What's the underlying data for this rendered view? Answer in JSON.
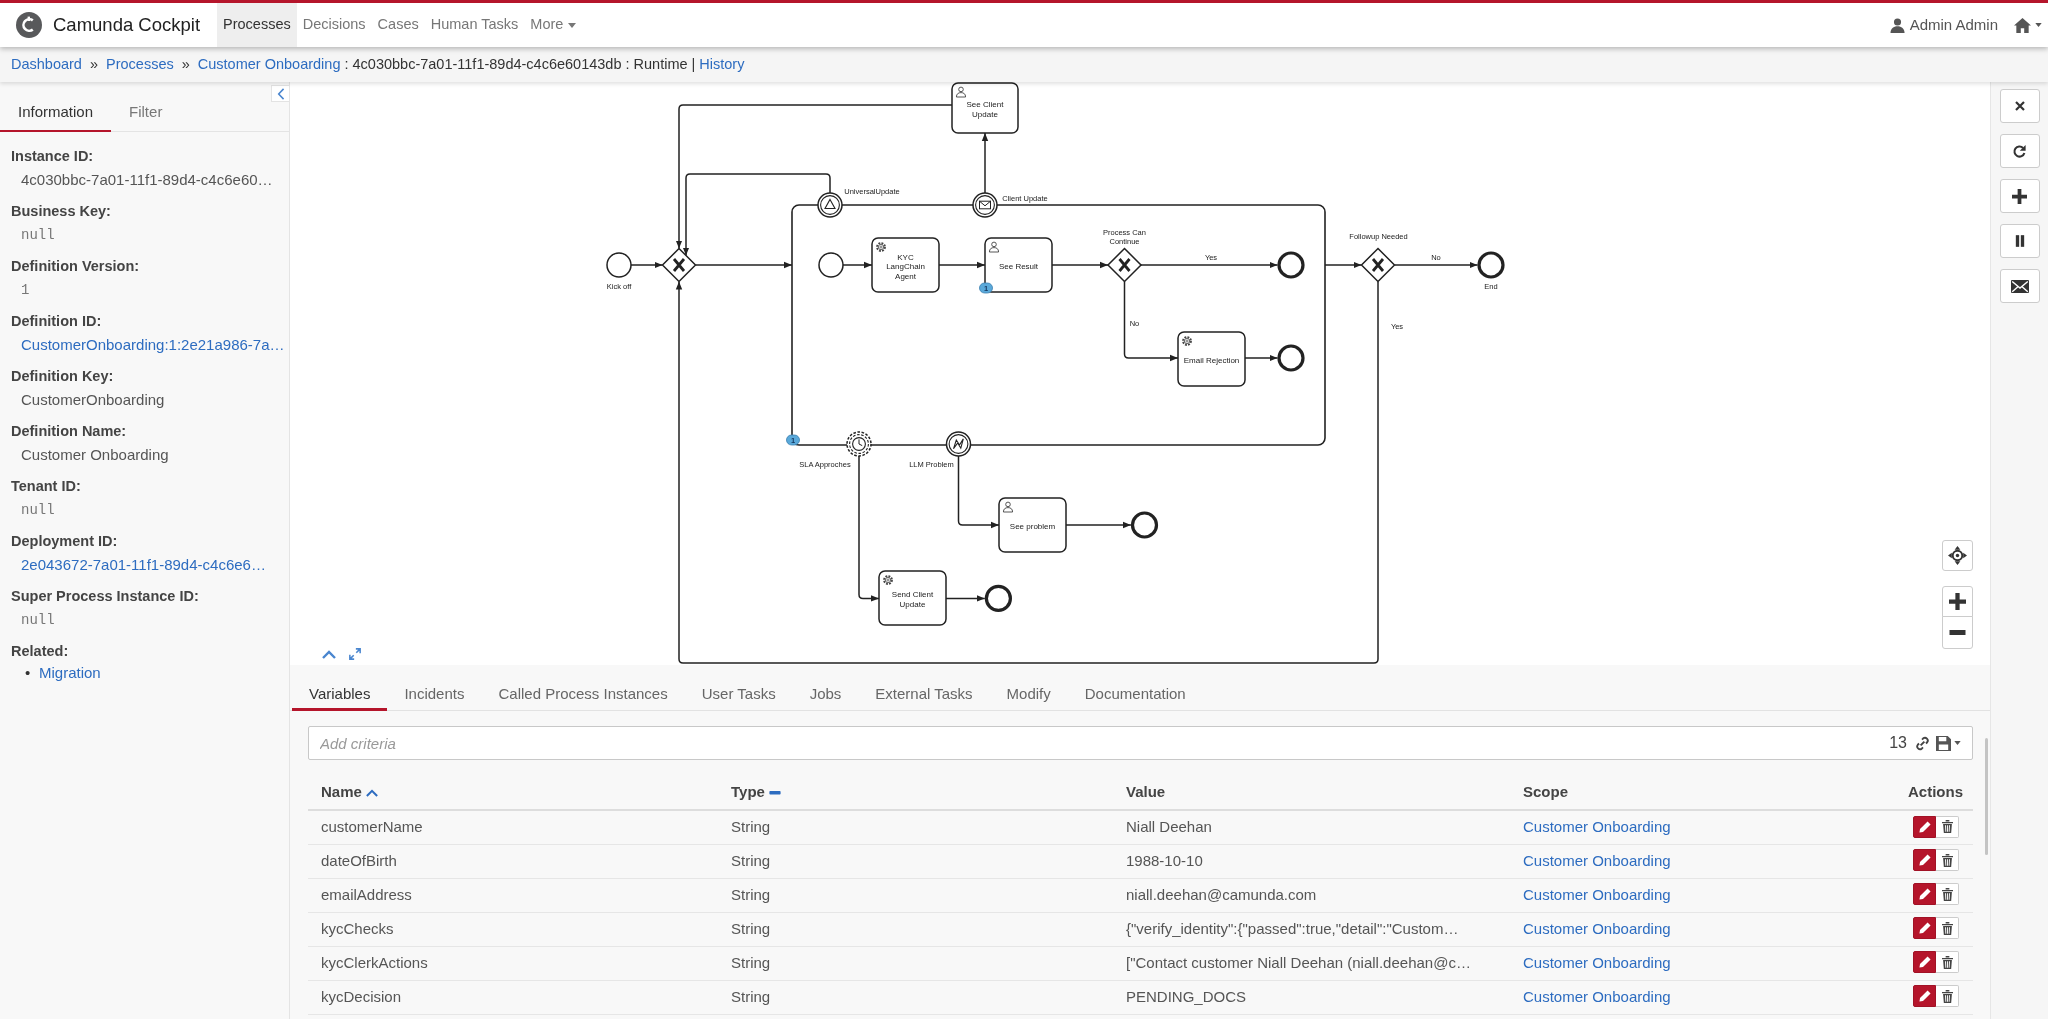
{
  "navbar": {
    "brand": "Camunda Cockpit",
    "items": [
      {
        "label": "Processes",
        "selected": true,
        "kind": "link"
      },
      {
        "label": "Decisions",
        "selected": false,
        "kind": "link"
      },
      {
        "label": "Cases",
        "selected": false,
        "kind": "link"
      },
      {
        "label": "Human Tasks",
        "selected": false,
        "kind": "link"
      },
      {
        "label": "More",
        "selected": false,
        "kind": "dropdown"
      }
    ],
    "user": "Admin Admin"
  },
  "breadcrumb": [
    {
      "kind": "link",
      "text": "Dashboard"
    },
    {
      "kind": "separator",
      "text": "»"
    },
    {
      "kind": "link",
      "text": "Processes"
    },
    {
      "kind": "separator",
      "text": "»"
    },
    {
      "kind": "link",
      "text": "Customer Onboarding"
    },
    {
      "kind": "separator",
      "text": ":"
    },
    {
      "kind": "text",
      "text": "4c030bbc-7a01-11f1-89d4-c4c6e60143db"
    },
    {
      "kind": "separator",
      "text": ":"
    },
    {
      "kind": "text",
      "text": "Runtime"
    },
    {
      "kind": "separator",
      "text": "|"
    },
    {
      "kind": "link",
      "text": "History"
    }
  ],
  "sidebar": {
    "tabs": [
      {
        "label": "Information",
        "selected": true
      },
      {
        "label": "Filter",
        "selected": false
      }
    ],
    "fields": [
      {
        "label": "Instance ID:",
        "value": "4c030bbc-7a01-11f1-89d4-c4c6e60…",
        "kind": "text"
      },
      {
        "label": "Business Key:",
        "value": "null",
        "kind": "code"
      },
      {
        "label": "Definition Version:",
        "value": "1",
        "kind": "code"
      },
      {
        "label": "Definition ID:",
        "value": "CustomerOnboarding:1:2e21a986-7a…",
        "kind": "link"
      },
      {
        "label": "Definition Key:",
        "value": "CustomerOnboarding",
        "kind": "text"
      },
      {
        "label": "Definition Name:",
        "value": "Customer Onboarding",
        "kind": "text"
      },
      {
        "label": "Tenant ID:",
        "value": "null",
        "kind": "code"
      },
      {
        "label": "Deployment ID:",
        "value": "2e043672-7a01-11f1-89d4-c4c6e6…",
        "kind": "link"
      },
      {
        "label": "Super Process Instance ID:",
        "value": "null",
        "kind": "code"
      }
    ],
    "related": {
      "label": "Related:",
      "links": [
        {
          "bullet": "•",
          "label": "Migration"
        }
      ]
    }
  },
  "diagram": {
    "elements": [
      {
        "kind": "start-event",
        "label": "Kick off"
      },
      {
        "kind": "exclusive-gateway"
      },
      {
        "kind": "sub-process",
        "badge": "1"
      },
      {
        "kind": "signal-boundary-event",
        "label": "UniversalUpdate"
      },
      {
        "kind": "message-boundary-event",
        "label": "Client Update"
      },
      {
        "kind": "user-task",
        "label": "See Client Update"
      },
      {
        "kind": "start-event"
      },
      {
        "kind": "service-task",
        "label": "KYC LangChain Agent"
      },
      {
        "kind": "user-task",
        "label": "See Result",
        "badge": "1"
      },
      {
        "kind": "exclusive-gateway",
        "label": "Process Can Continue"
      },
      {
        "kind": "end-event"
      },
      {
        "kind": "service-task",
        "label": "Email Rejection"
      },
      {
        "kind": "end-event"
      },
      {
        "kind": "exclusive-gateway",
        "label": "Followup Needed"
      },
      {
        "kind": "end-event",
        "label": "End"
      },
      {
        "kind": "timer-boundary-event",
        "label": "SLA Approches"
      },
      {
        "kind": "error-boundary-event",
        "label": "LLM Problem"
      },
      {
        "kind": "user-task",
        "label": "See problem"
      },
      {
        "kind": "end-event"
      },
      {
        "kind": "service-task",
        "label": "Send Client Update"
      },
      {
        "kind": "end-event"
      }
    ],
    "flow_labels": [
      "Yes",
      "No",
      "No",
      "Yes"
    ]
  },
  "detail_tabs": [
    {
      "label": "Variables",
      "selected": true
    },
    {
      "label": "Incidents",
      "selected": false
    },
    {
      "label": "Called Process Instances",
      "selected": false
    },
    {
      "label": "User Tasks",
      "selected": false
    },
    {
      "label": "Jobs",
      "selected": false
    },
    {
      "label": "External Tasks",
      "selected": false
    },
    {
      "label": "Modify",
      "selected": false
    },
    {
      "label": "Documentation",
      "selected": false
    }
  ],
  "variables": {
    "placeholder": "Add criteria",
    "count": "13",
    "columns": [
      {
        "label": "Name",
        "kind": "ascending"
      },
      {
        "label": "Type",
        "kind": "unsorted"
      },
      {
        "label": "Value",
        "kind": "plain"
      },
      {
        "label": "Scope",
        "kind": "plain"
      },
      {
        "label": "Actions",
        "kind": "plain"
      }
    ],
    "rows": [
      {
        "name": "customerName",
        "type": "String",
        "value": "Niall Deehan",
        "scope": "Customer Onboarding"
      },
      {
        "name": "dateOfBirth",
        "type": "String",
        "value": "1988-10-10",
        "scope": "Customer Onboarding"
      },
      {
        "name": "emailAddress",
        "type": "String",
        "value": "niall.deehan@camunda.com",
        "scope": "Customer Onboarding"
      },
      {
        "name": "kycChecks",
        "type": "String",
        "value": "{\"verify_identity\":{\"passed\":true,\"detail\":\"Custom…",
        "scope": "Customer Onboarding"
      },
      {
        "name": "kycClerkActions",
        "type": "String",
        "value": "[\"Contact customer Niall Deehan (niall.deehan@c…",
        "scope": "Customer Onboarding"
      },
      {
        "name": "kycDecision",
        "type": "String",
        "value": "PENDING_DOCS",
        "scope": "Customer Onboarding"
      }
    ]
  }
}
